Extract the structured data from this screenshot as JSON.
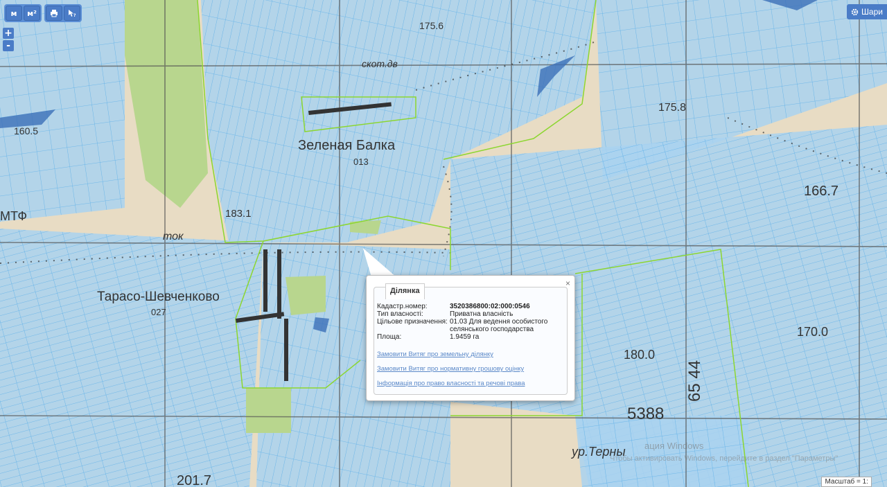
{
  "toolbar": {
    "measure_line": "м",
    "measure_area": "м²",
    "print_icon": "printer-icon",
    "identify_icon": "pointer-help-icon"
  },
  "zoom": {
    "in": "+",
    "out": "-"
  },
  "layers_button": {
    "label": "Шари",
    "icon": "gear-icon"
  },
  "map_labels": {
    "zelena_balka": "Зеленая Балка",
    "zelena_balka_code": "013",
    "taras": "Тарасо-Шевченково",
    "taras_code": "027",
    "terny": "ур.Терны",
    "tok": "ток",
    "skot": "скот.дв",
    "mtf": "МТФ",
    "h1": "175.6",
    "h2": "175.8",
    "h3": "166.7",
    "h4": "170.0",
    "h5": "180.0",
    "h6": "183.1",
    "h7": "201.7",
    "h8": "160.5",
    "grid1": "5388",
    "grid2": "65 44"
  },
  "popup": {
    "tab": "Ділянка",
    "close": "×",
    "fields": [
      {
        "k": "Кадастр.номер:",
        "v": "3520386800:02:000:0546"
      },
      {
        "k": "Тип власності:",
        "v": "Приватна власність"
      },
      {
        "k": "Цільове призначення:",
        "v": "01.03 Для ведення особистого селянського господарства"
      },
      {
        "k": "Площа:",
        "v": "1.9459 га"
      }
    ],
    "links": [
      "Замовити Витяг про земельну ділянку",
      "Замовити Витяг про нормативну грошову оцінку",
      "Інформація про право власності та речові права"
    ]
  },
  "watermark": {
    "line1": "ация Windows",
    "line2": "Чтобы активировать Windows, перейдите в раздел \"Параметры\""
  },
  "scale": {
    "label": "Масштаб = 1:"
  },
  "colors": {
    "parcel_fill": "#a9d3f0",
    "parcel_line": "#5aaee8",
    "boundary": "#8cd630",
    "forest": "#b8d68e",
    "base": "#e8dcc4",
    "ui_blue": "#4a7cc7"
  }
}
